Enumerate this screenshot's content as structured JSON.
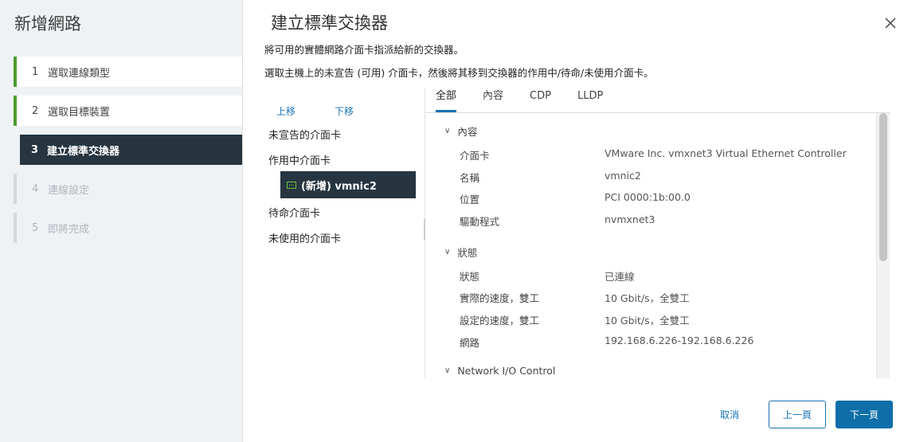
{
  "wizard": {
    "title": "新增網路",
    "steps": [
      {
        "num": "1",
        "label": "選取連線類型",
        "state": "done"
      },
      {
        "num": "2",
        "label": "選取目標裝置",
        "state": "done"
      },
      {
        "num": "3",
        "label": "建立標準交換器",
        "state": "active"
      },
      {
        "num": "4",
        "label": "連線設定",
        "state": "pending"
      },
      {
        "num": "5",
        "label": "即將完成",
        "state": "pending"
      }
    ]
  },
  "main": {
    "title": "建立標準交換器",
    "desc1": "將可用的實體網路介面卡指派給新的交換器。",
    "desc2": "選取主機上的未宣告 (可用) 介面卡，然後將其移到交換器的作用中/待命/未使用介面卡。"
  },
  "adapters": {
    "move_up": "上移",
    "move_down": "下移",
    "unclaimed": "未宣告的介面卡",
    "active": "作用中介面卡",
    "selected_nic": "(新增) vmnic2",
    "standby": "待命介面卡",
    "unused": "未使用的介面卡"
  },
  "detail": {
    "tabs": [
      "全部",
      "內容",
      "CDP",
      "LLDP"
    ],
    "sections": {
      "properties": "內容",
      "status": "狀態",
      "nioc": "Network I/O Control"
    },
    "properties": [
      {
        "label": "介面卡",
        "value": "VMware Inc. vmxnet3 Virtual Ethernet Controller"
      },
      {
        "label": "名稱",
        "value": "vmnic2"
      },
      {
        "label": "位置",
        "value": "PCI 0000:1b:00.0"
      },
      {
        "label": "驅動程式",
        "value": "nvmxnet3"
      }
    ],
    "status": [
      {
        "label": "狀態",
        "value": "已連線"
      },
      {
        "label": "實際的速度，雙工",
        "value": "10 Gbit/s，全雙工"
      },
      {
        "label": "設定的速度，雙工",
        "value": "10 Gbit/s，全雙工"
      },
      {
        "label": "網路",
        "value": "192.168.6.226-192.168.6.226"
      }
    ]
  },
  "footer": {
    "cancel": "取消",
    "back": "上一頁",
    "next": "下一頁"
  },
  "colors": {
    "accent": "#1a73b5",
    "done_step": "#4d9c2c",
    "active_bg": "#263540"
  }
}
